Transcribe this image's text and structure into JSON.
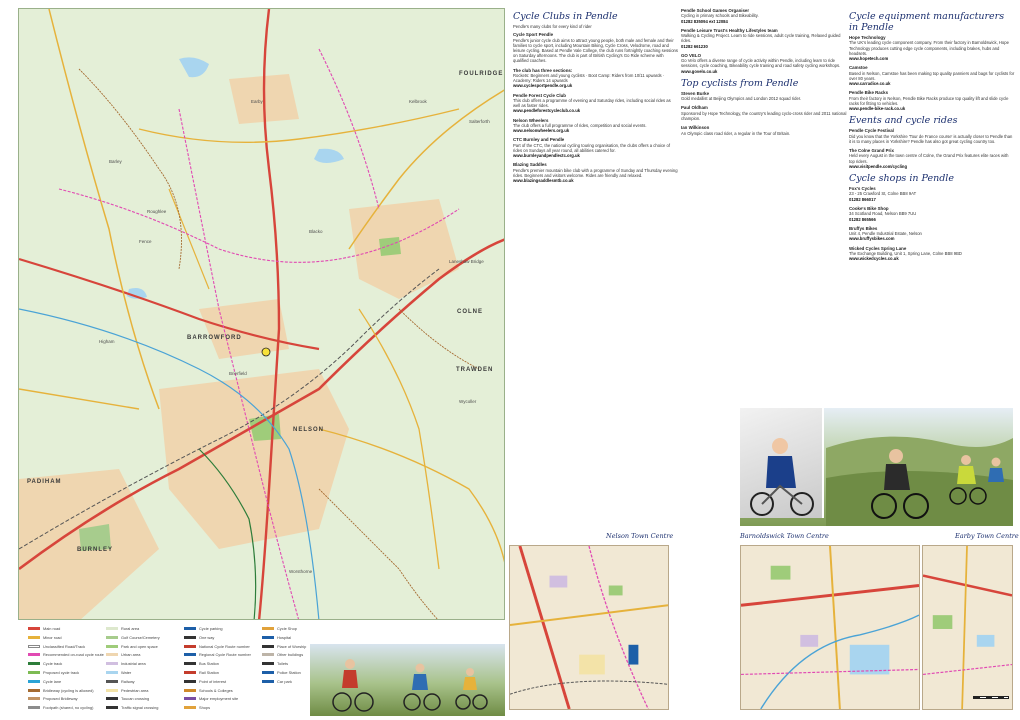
{
  "map": {
    "towns": [
      {
        "id": "burnley",
        "name": "BURNLEY"
      },
      {
        "id": "nelson",
        "name": "NELSON"
      },
      {
        "id": "colne",
        "name": "COLNE"
      },
      {
        "id": "barrowford",
        "name": "BARROWFORD"
      },
      {
        "id": "trawden",
        "name": "TRAWDEN"
      },
      {
        "id": "foulridge",
        "name": "FOULRIDGE"
      },
      {
        "id": "padiham",
        "name": "PADIHAM"
      },
      {
        "id": "fence",
        "name": "Fence"
      },
      {
        "id": "brierfield",
        "name": "Brierfield"
      },
      {
        "id": "roughlee",
        "name": "Roughlee"
      },
      {
        "id": "higham",
        "name": "Higham"
      },
      {
        "id": "worsthorne",
        "name": "Worsthorne"
      },
      {
        "id": "laneshaw-bridge",
        "name": "Laneshaw Bridge"
      },
      {
        "id": "kelbrook",
        "name": "Kelbrook"
      },
      {
        "id": "salterforth",
        "name": "Salterforth"
      },
      {
        "id": "barley",
        "name": "Barley"
      },
      {
        "id": "wycoller",
        "name": "Wycoller"
      },
      {
        "id": "blacko",
        "name": "Blacko"
      },
      {
        "id": "earby",
        "name": "Earby"
      }
    ]
  },
  "panel": {
    "clubs_heading": "Cycle Clubs in Pendle",
    "clubs_intro": "Pendle's many clubs for every kind of rider",
    "clubs": [
      {
        "name": "Cycle Sport Pendle",
        "desc": "Pendle's junior cycle club aims to attract young people, both male and female and their families to cycle sport, including Mountain Biking, Cycle Cross, Velodrome, road and leisure cycling. Based at Pendle Vale College, the club runs fortnightly coaching sessions on Saturday afternoons. The club is part of British Cycling's Go Ride scheme with qualified coaches.",
        "url": ""
      },
      {
        "name": "The club has three sections:",
        "desc": "Rockets: Beginners and young cyclists · Boot Camp: Riders from 10/11 upwards · Academy: Riders 14 upwards",
        "url": "www.cyclesportpendle.org.uk"
      },
      {
        "name": "Pendle Forest Cycle Club",
        "desc": "This club offers a programme of evening and Saturday rides, including social rides as well as faster rides.",
        "url": "www.pendleforestcycleclub.co.uk"
      },
      {
        "name": "Nelson Wheelers",
        "desc": "The club offers a full programme of rides, competition and social events.",
        "url": "www.nelsonwheelers.org.uk"
      },
      {
        "name": "CTC Burnley and Pendle",
        "desc": "Part of the CTC, the national cycling touring organisation, the clubs offers a choice of rides on Sundays all year round, all abilities catered for.",
        "url": "www.burnleyandpendlectc.org.uk"
      },
      {
        "name": "Blazing Saddles",
        "desc": "Pendle's premier mountain bike club with a programme of Sunday and Thursday evening rides. Beginners and visitors welcome. Rides are friendly and relaxed.",
        "url": "www.blazingsaddlesmtb.co.uk"
      },
      {
        "name": "Pendle School Games Organiser",
        "desc": "Cycling in primary schools and Bikeability.",
        "url": "01282 835094 ext 12084"
      },
      {
        "name": "Pendle Leisure Trust's Healthy Lifestyles team",
        "desc": "Walking & Cycling Project. Learn to ride sessions, adult cycle training, Relaxed guided rides.",
        "url": "01282 661230"
      },
      {
        "name": "GO VELO",
        "desc": "Go Velo offers a diverse range of cycle activity within Pendle, including learn to ride sessions, cycle coaching, Bikeability cycle training and road safety cycling workshops.",
        "url": "www.govelo.co.uk"
      }
    ],
    "equipment_heading": "Cycle equipment manufacturers in Pendle",
    "equipment": [
      {
        "name": "Hope Technology",
        "desc": "The UK's leading cycle component company. From their factory in Barnoldswick, Hope Technology produces cutting edge cycle components, including brakes, hubs and headsets.",
        "url": "www.hopetech.com"
      },
      {
        "name": "Camstoe",
        "desc": "Based in Nelson, Camstoe has been making top quality panniers and bags for cyclists for over 80 years.",
        "url": "www.carradice.co.uk"
      },
      {
        "name": "Pendle Bike Racks",
        "desc": "From their factory in Nelson, Pendle Bike Racks produce top quality lift and slide cycle racks for fitting to vehicles.",
        "url": "www.pendle-bike-rack.co.uk"
      }
    ],
    "events_heading": "Events and cycle rides",
    "events": [
      {
        "name": "Pendle Cycle Festival",
        "desc": "Did you know that the Yorkshire 'Tour de France course' is actually closer to Pendle than it is to many places in Yorkshire? Pendle has also got great cycling country too.",
        "url": ""
      },
      {
        "name": "The Colne Grand Prix",
        "desc": "Held every August in the town centre of Colne, the Grand Prix features elite races with top riders.",
        "url": "www.visitpendle.com/cycling"
      }
    ],
    "shops_heading": "Cycle shops in Pendle",
    "shops": [
      {
        "name": "Fox's Cycles",
        "desc": "23 - 25 Crawford St, Colne BB8 9AT",
        "url": "01282 866017"
      },
      {
        "name": "Cooke's Bike Shop",
        "desc": "34 Scotland Road, Nelson BB9 7UU",
        "url": "01282 865566"
      },
      {
        "name": "Bruffys Bikes",
        "desc": "Unit 4, Pendle Industrial Estate, Nelson",
        "url": "www.bruffysbikes.com"
      },
      {
        "name": "Wicked Cycles Spring Lane",
        "desc": "The Exchange Building, Unit 1, Spring Lane, Colne BB8 9BD",
        "url": "www.wickedcycles.co.uk"
      }
    ],
    "top_cyclists_heading": "Top cyclists from Pendle",
    "top_cyclists": [
      {
        "name": "Steven Burke",
        "desc": "Gold medallist at Beijing Olympics and London 2012 squad rider.",
        "url": ""
      },
      {
        "name": "Paul Oldham",
        "desc": "Sponsored by Hope Technology, the country's leading cyclo-cross rider and 2011 national champion.",
        "url": ""
      },
      {
        "name": "Ian Wilkinson",
        "desc": "An Olympic class road rider, a regular in the Tour of Britain.",
        "url": ""
      }
    ]
  },
  "insets": [
    {
      "id": "nelson-town-centre",
      "title": "Nelson Town Centre"
    },
    {
      "id": "barnoldswick-town-centre",
      "title": "Barnoldswick Town Centre"
    },
    {
      "id": "earby-town-centre",
      "title": "Earby Town Centre"
    }
  ],
  "legend": {
    "items": [
      {
        "label": "Main road",
        "color": "#d7453b"
      },
      {
        "label": "Minor road",
        "color": "#e6b23b"
      },
      {
        "label": "Unclassified Road/Track",
        "color": "#ffffff"
      },
      {
        "label": "Recommended on-road cycle route",
        "color": "#e14ab3"
      },
      {
        "label": "Cycle track",
        "color": "#2d7d3a"
      },
      {
        "label": "Proposed cycle track",
        "color": "#7dbb53"
      },
      {
        "label": "Cycle lane",
        "color": "#29a3d6"
      },
      {
        "label": "Bridleway (cycling is allowed)",
        "color": "#a56b31"
      },
      {
        "label": "Proposed Bridleway",
        "color": "#c29464"
      },
      {
        "label": "Footpath (shared, no cycling)",
        "color": "#8c8c8c"
      },
      {
        "label": "Rural area",
        "color": "#dde8cd"
      },
      {
        "label": "Golf Course/Cemetery",
        "color": "#a7cc8d"
      },
      {
        "label": "Park and open space",
        "color": "#9fcc7a"
      },
      {
        "label": "Urban area",
        "color": "#efd6b0"
      },
      {
        "label": "Industrial area",
        "color": "#d1bfe0"
      },
      {
        "label": "Water",
        "color": "#a9d5ef"
      },
      {
        "label": "Railway",
        "color": "#555555"
      },
      {
        "label": "Pedestrian area",
        "color": "#f3e3a8"
      },
      {
        "label": "Toucan crossing",
        "color": "#333333"
      },
      {
        "label": "Traffic signal crossing",
        "color": "#333333"
      },
      {
        "label": "Cycle parking",
        "color": "#1d5fa8"
      },
      {
        "label": "One way",
        "color": "#333333"
      },
      {
        "label": "National Cycle Route number",
        "color": "#c43c2c"
      },
      {
        "label": "Regional Cycle Route number",
        "color": "#1d5fa8"
      },
      {
        "label": "Bus Station",
        "color": "#333333"
      },
      {
        "label": "Rail Station",
        "color": "#c43c2c"
      },
      {
        "label": "Point of interest",
        "color": "#333333"
      },
      {
        "label": "Schools & Colleges",
        "color": "#d08a2a"
      },
      {
        "label": "Major employment site",
        "color": "#7a4ea3"
      },
      {
        "label": "Shops",
        "color": "#e1a23b"
      },
      {
        "label": "Cycle Shop",
        "color": "#e1a23b"
      },
      {
        "label": "Hospital",
        "color": "#1d5fa8"
      },
      {
        "label": "Place of Worship",
        "color": "#333333"
      },
      {
        "label": "Other buildings",
        "color": "#bdb4a8"
      },
      {
        "label": "Toilets",
        "color": "#333333"
      },
      {
        "label": "Police Station",
        "color": "#1d5fa8"
      },
      {
        "label": "Car park",
        "color": "#1d5fa8"
      }
    ]
  },
  "colors": {
    "heading": "#1b2f6e",
    "rural": "#e4efd7",
    "urban": "#efd6b0",
    "main_road": "#d7453b",
    "minor_road": "#e6b23b",
    "cycle_route": "#e14ab3",
    "water": "#a9d5ef"
  }
}
